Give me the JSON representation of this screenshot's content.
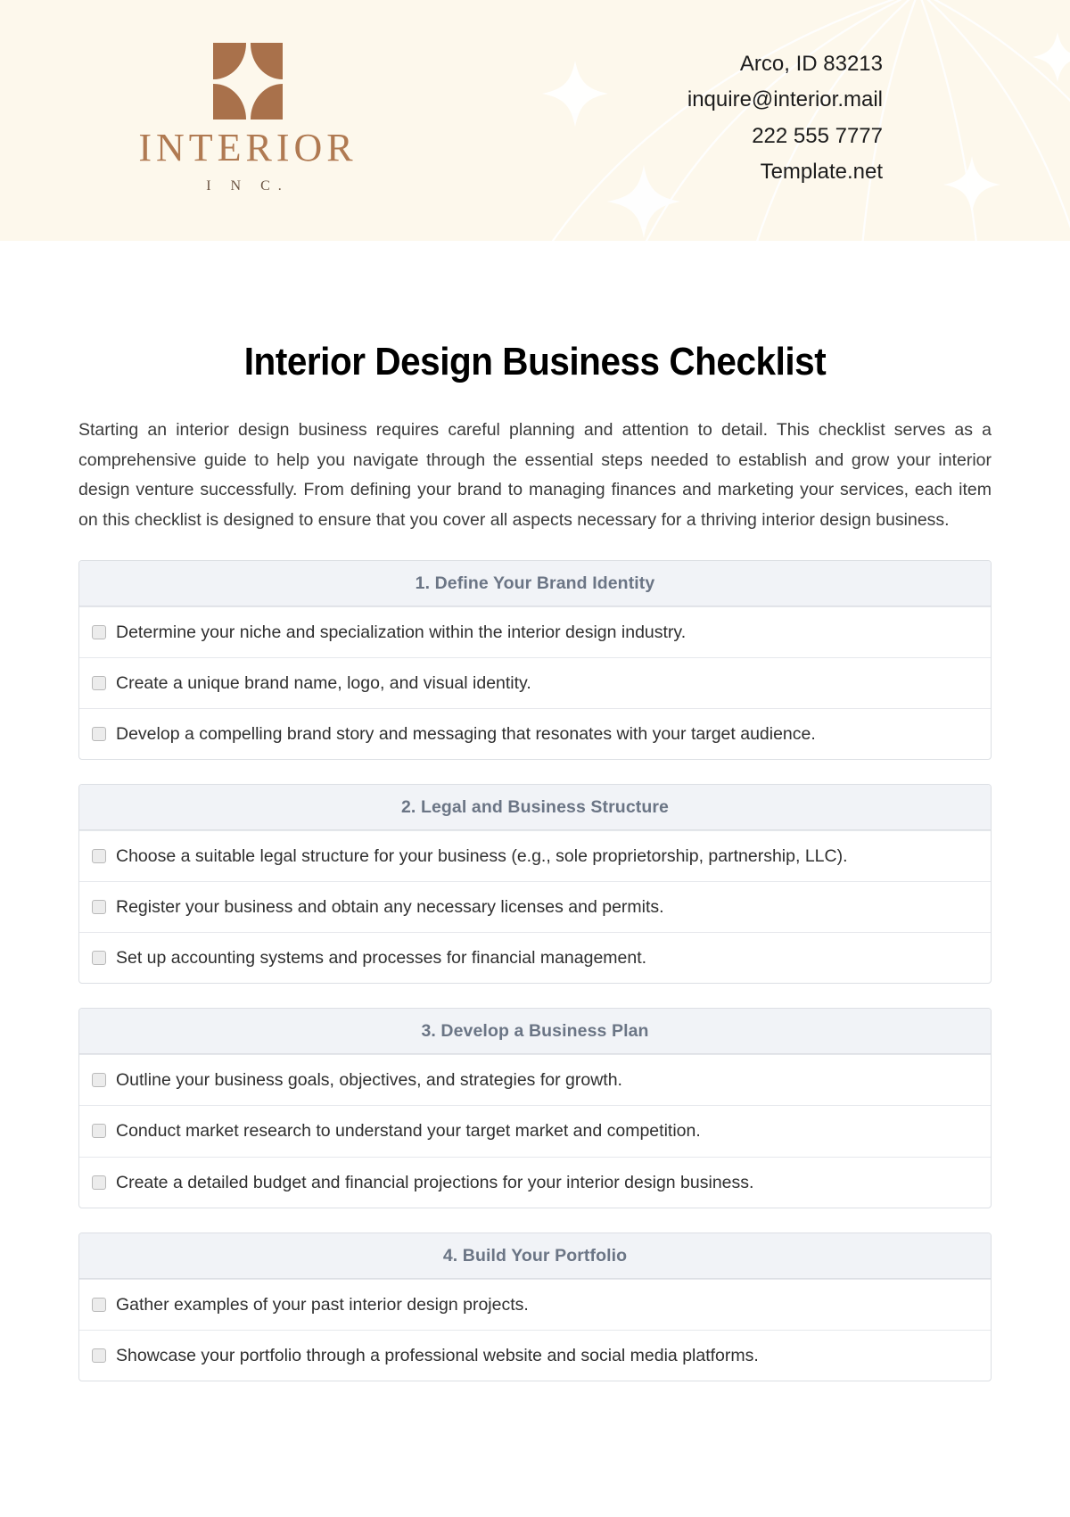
{
  "brand": {
    "logo_icon": "interior-inc-logo-mark",
    "name": "INTERIOR",
    "sub": "I N C.",
    "mark_color": "#A9714B",
    "name_color": "#B07A52"
  },
  "header": {
    "background_color": "#FDF8EC",
    "decoration": "globe-meridian-arcs-and-sparkles",
    "contact": [
      "Arco, ID 83213",
      "inquire@interior.mail",
      "222 555 7777",
      "Template.net"
    ]
  },
  "document": {
    "title": "Interior Design Business Checklist",
    "intro": "Starting an interior design business requires careful planning and attention to detail. This checklist serves as a comprehensive guide to help you navigate through the essential steps needed to establish and grow your interior design venture successfully. From defining your brand to managing finances and marketing your services, each item on this checklist is designed to ensure that you cover all aspects necessary for a thriving interior design business."
  },
  "sections": [
    {
      "heading": "1. Define Your Brand Identity",
      "items": [
        "Determine your niche and specialization within the interior design industry.",
        "Create a unique brand name, logo, and visual identity.",
        "Develop a compelling brand story and messaging that resonates with your target audience."
      ]
    },
    {
      "heading": "2. Legal and Business Structure",
      "items": [
        "Choose a suitable legal structure for your business (e.g., sole proprietorship, partnership, LLC).",
        "Register your business and obtain any necessary licenses and permits.",
        "Set up accounting systems and processes for financial management."
      ]
    },
    {
      "heading": "3. Develop a Business Plan",
      "items": [
        "Outline your business goals, objectives, and strategies for growth.",
        "Conduct market research to understand your target market and competition.",
        "Create a detailed budget and financial projections for your interior design business."
      ]
    },
    {
      "heading": "4. Build Your Portfolio",
      "items": [
        "Gather examples of your past interior design projects.",
        "Showcase your portfolio through a professional website and social media platforms."
      ]
    }
  ],
  "theme": {
    "header_band": "#FDF8EC",
    "section_header_bg": "#F1F3F7",
    "section_header_text": "#6b7585",
    "body_text": "#3b3b3b",
    "checkbox_fill": "#ececec",
    "checkbox_border": "#b9b9b9"
  }
}
